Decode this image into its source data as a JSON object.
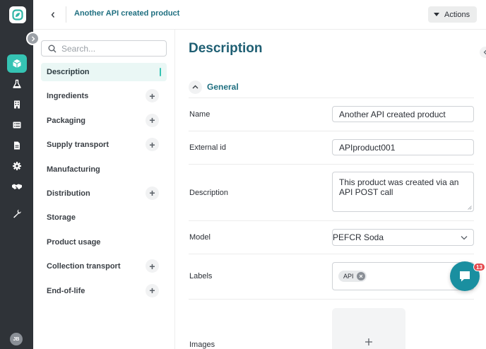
{
  "header": {
    "title": "Another API created product",
    "actions_label": "Actions"
  },
  "rail": {
    "items": [
      {
        "icon": "box-icon",
        "active": true
      },
      {
        "icon": "flask-icon",
        "active": false
      },
      {
        "icon": "building-icon",
        "active": false
      },
      {
        "icon": "list-icon",
        "active": false
      },
      {
        "icon": "document-icon",
        "active": false
      },
      {
        "icon": "gear-icon",
        "active": false
      },
      {
        "icon": "handshake-icon",
        "active": false
      },
      {
        "icon": "wrench-icon",
        "active": false
      }
    ],
    "avatar_initials": "JB"
  },
  "sidebar": {
    "search_placeholder": "Search...",
    "items": [
      {
        "label": "Description",
        "active": true,
        "expandable": false
      },
      {
        "label": "Ingredients",
        "active": false,
        "expandable": true
      },
      {
        "label": "Packaging",
        "active": false,
        "expandable": true
      },
      {
        "label": "Supply transport",
        "active": false,
        "expandable": true
      },
      {
        "label": "Manufacturing",
        "active": false,
        "expandable": false
      },
      {
        "label": "Distribution",
        "active": false,
        "expandable": true
      },
      {
        "label": "Storage",
        "active": false,
        "expandable": false
      },
      {
        "label": "Product usage",
        "active": false,
        "expandable": false
      },
      {
        "label": "Collection transport",
        "active": false,
        "expandable": true
      },
      {
        "label": "End-of-life",
        "active": false,
        "expandable": true
      }
    ]
  },
  "main": {
    "title": "Description",
    "section_label": "General",
    "fields": {
      "name_label": "Name",
      "name_value": "Another API created product",
      "external_id_label": "External id",
      "external_id_value": "APIproduct001",
      "description_label": "Description",
      "description_value": "This product was created via an API POST call",
      "model_label": "Model",
      "model_value": "PEFCR Soda",
      "labels_label": "Labels",
      "label_chip": "API",
      "images_label": "Images"
    }
  },
  "chat": {
    "badge_count": "13"
  },
  "colors": {
    "accent": "#35c3b3",
    "title": "#1f5f73",
    "rail": "#2f3338",
    "chat": "#1a8fa0",
    "badge": "#e5484d"
  }
}
